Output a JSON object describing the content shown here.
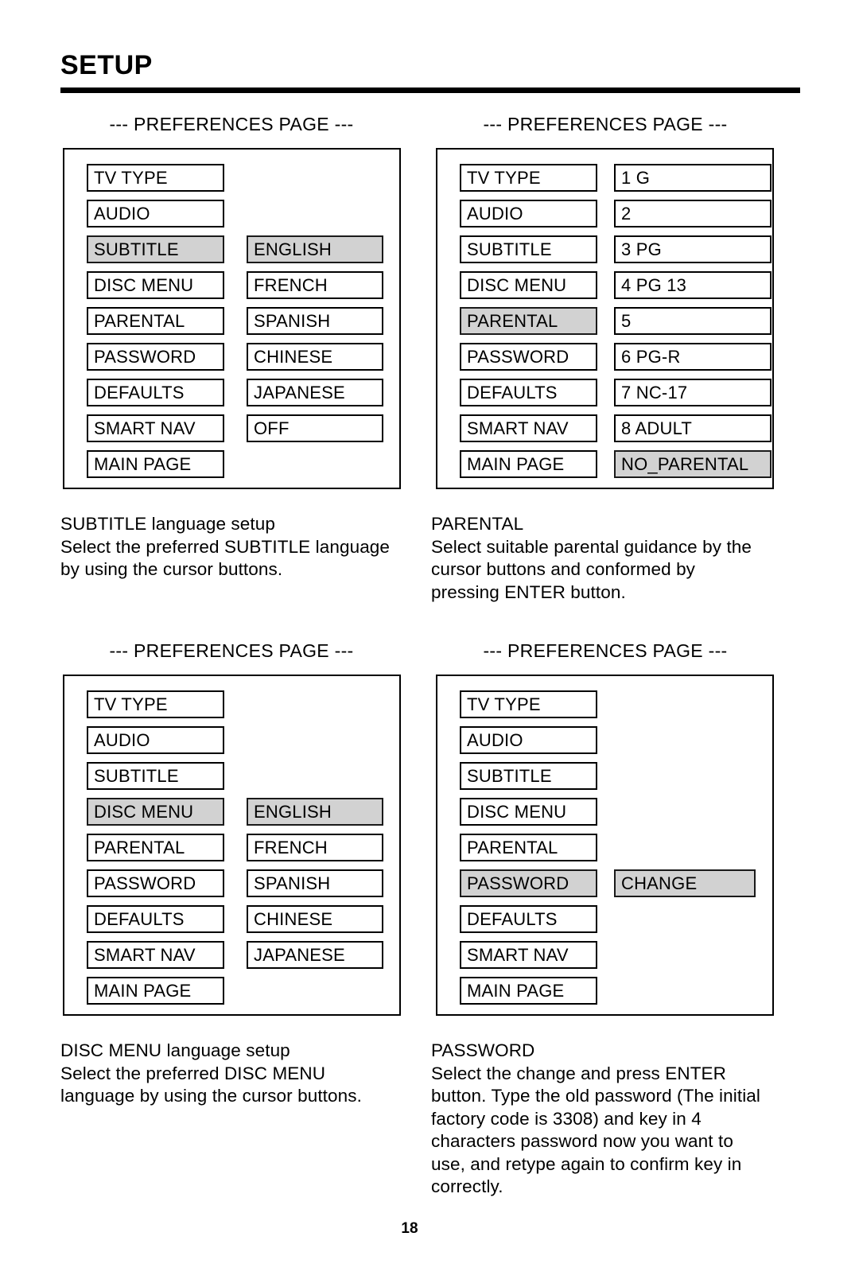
{
  "document": {
    "title": "SETUP",
    "page_number": "18"
  },
  "menu_labels": {
    "tv_type": "TV TYPE",
    "audio": "AUDIO",
    "subtitle": "SUBTITLE",
    "disc_menu": "DISC MENU",
    "parental": "PARENTAL",
    "password": "PASSWORD",
    "defaults": "DEFAULTS",
    "smart_nav": "SMART NAV",
    "main_page": "MAIN PAGE"
  },
  "panels": [
    {
      "id": "subtitle-panel",
      "header": "--- PREFERENCES PAGE ---",
      "left_items": [
        {
          "label": "TV TYPE",
          "selected": false
        },
        {
          "label": "AUDIO",
          "selected": false
        },
        {
          "label": "SUBTITLE",
          "selected": true
        },
        {
          "label": "DISC MENU",
          "selected": false
        },
        {
          "label": "PARENTAL",
          "selected": false
        },
        {
          "label": "PASSWORD",
          "selected": false
        },
        {
          "label": "DEFAULTS",
          "selected": false
        },
        {
          "label": "SMART NAV",
          "selected": false
        },
        {
          "label": "MAIN PAGE",
          "selected": false
        }
      ],
      "right_start_row": 2,
      "right_items": [
        {
          "label": "ENGLISH",
          "selected": true
        },
        {
          "label": "FRENCH",
          "selected": false
        },
        {
          "label": "SPANISH",
          "selected": false
        },
        {
          "label": "CHINESE",
          "selected": false
        },
        {
          "label": "JAPANESE",
          "selected": false
        },
        {
          "label": "OFF",
          "selected": false
        }
      ],
      "caption": {
        "heading": "SUBTITLE language setup",
        "lines": [
          "Select the preferred SUBTITLE language",
          "by using the cursor buttons."
        ]
      }
    },
    {
      "id": "parental-panel",
      "header": "--- PREFERENCES PAGE ---",
      "left_items": [
        {
          "label": "TV TYPE",
          "selected": false
        },
        {
          "label": "AUDIO",
          "selected": false
        },
        {
          "label": "SUBTITLE",
          "selected": false
        },
        {
          "label": "DISC MENU",
          "selected": false
        },
        {
          "label": "PARENTAL",
          "selected": true
        },
        {
          "label": "PASSWORD",
          "selected": false
        },
        {
          "label": "DEFAULTS",
          "selected": false
        },
        {
          "label": "SMART NAV",
          "selected": false
        },
        {
          "label": "MAIN PAGE",
          "selected": false
        }
      ],
      "right_start_row": 0,
      "right_items": [
        {
          "label": "1 G",
          "selected": false
        },
        {
          "label": "2",
          "selected": false
        },
        {
          "label": "3 PG",
          "selected": false
        },
        {
          "label": "4 PG 13",
          "selected": false
        },
        {
          "label": "5",
          "selected": false
        },
        {
          "label": "6 PG-R",
          "selected": false
        },
        {
          "label": "7 NC-17",
          "selected": false
        },
        {
          "label": "8 ADULT",
          "selected": false
        },
        {
          "label": "NO_PARENTAL",
          "selected": true
        }
      ],
      "caption": {
        "heading": "PARENTAL",
        "lines": [
          "Select suitable parental guidance by the",
          "cursor buttons and conformed by",
          "pressing ENTER button."
        ]
      }
    },
    {
      "id": "disc-menu-panel",
      "header": "--- PREFERENCES PAGE ---",
      "left_items": [
        {
          "label": "TV TYPE",
          "selected": false
        },
        {
          "label": "AUDIO",
          "selected": false
        },
        {
          "label": "SUBTITLE",
          "selected": false
        },
        {
          "label": "DISC MENU",
          "selected": true
        },
        {
          "label": "PARENTAL",
          "selected": false
        },
        {
          "label": "PASSWORD",
          "selected": false
        },
        {
          "label": "DEFAULTS",
          "selected": false
        },
        {
          "label": "SMART NAV",
          "selected": false
        },
        {
          "label": "MAIN PAGE",
          "selected": false
        }
      ],
      "right_start_row": 3,
      "right_items": [
        {
          "label": "ENGLISH",
          "selected": true
        },
        {
          "label": "FRENCH",
          "selected": false
        },
        {
          "label": "SPANISH",
          "selected": false
        },
        {
          "label": "CHINESE",
          "selected": false
        },
        {
          "label": "JAPANESE",
          "selected": false
        }
      ],
      "caption": {
        "heading": "DISC MENU language setup",
        "lines": [
          "Select the preferred DISC MENU",
          "language by using the cursor buttons."
        ]
      }
    },
    {
      "id": "password-panel",
      "header": "--- PREFERENCES PAGE ---",
      "left_items": [
        {
          "label": "TV TYPE",
          "selected": false
        },
        {
          "label": "AUDIO",
          "selected": false
        },
        {
          "label": "SUBTITLE",
          "selected": false
        },
        {
          "label": "DISC MENU",
          "selected": false
        },
        {
          "label": "PARENTAL",
          "selected": false
        },
        {
          "label": "PASSWORD",
          "selected": true
        },
        {
          "label": "DEFAULTS",
          "selected": false
        },
        {
          "label": "SMART NAV",
          "selected": false
        },
        {
          "label": "MAIN PAGE",
          "selected": false
        }
      ],
      "right_start_row": 5,
      "right_items": [
        {
          "label": "CHANGE",
          "selected": true
        }
      ],
      "caption": {
        "heading": "PASSWORD",
        "lines": [
          "Select the change and press ENTER",
          "button.  Type the old password (The initial",
          "factory code is 3308) and key in 4",
          "characters password now you want to",
          "use, and retype again to confirm key in",
          "correctly."
        ]
      }
    }
  ],
  "colors": {
    "highlight": "#d2d2d2",
    "border": "#000000",
    "text": "#000000",
    "background": "#ffffff"
  }
}
